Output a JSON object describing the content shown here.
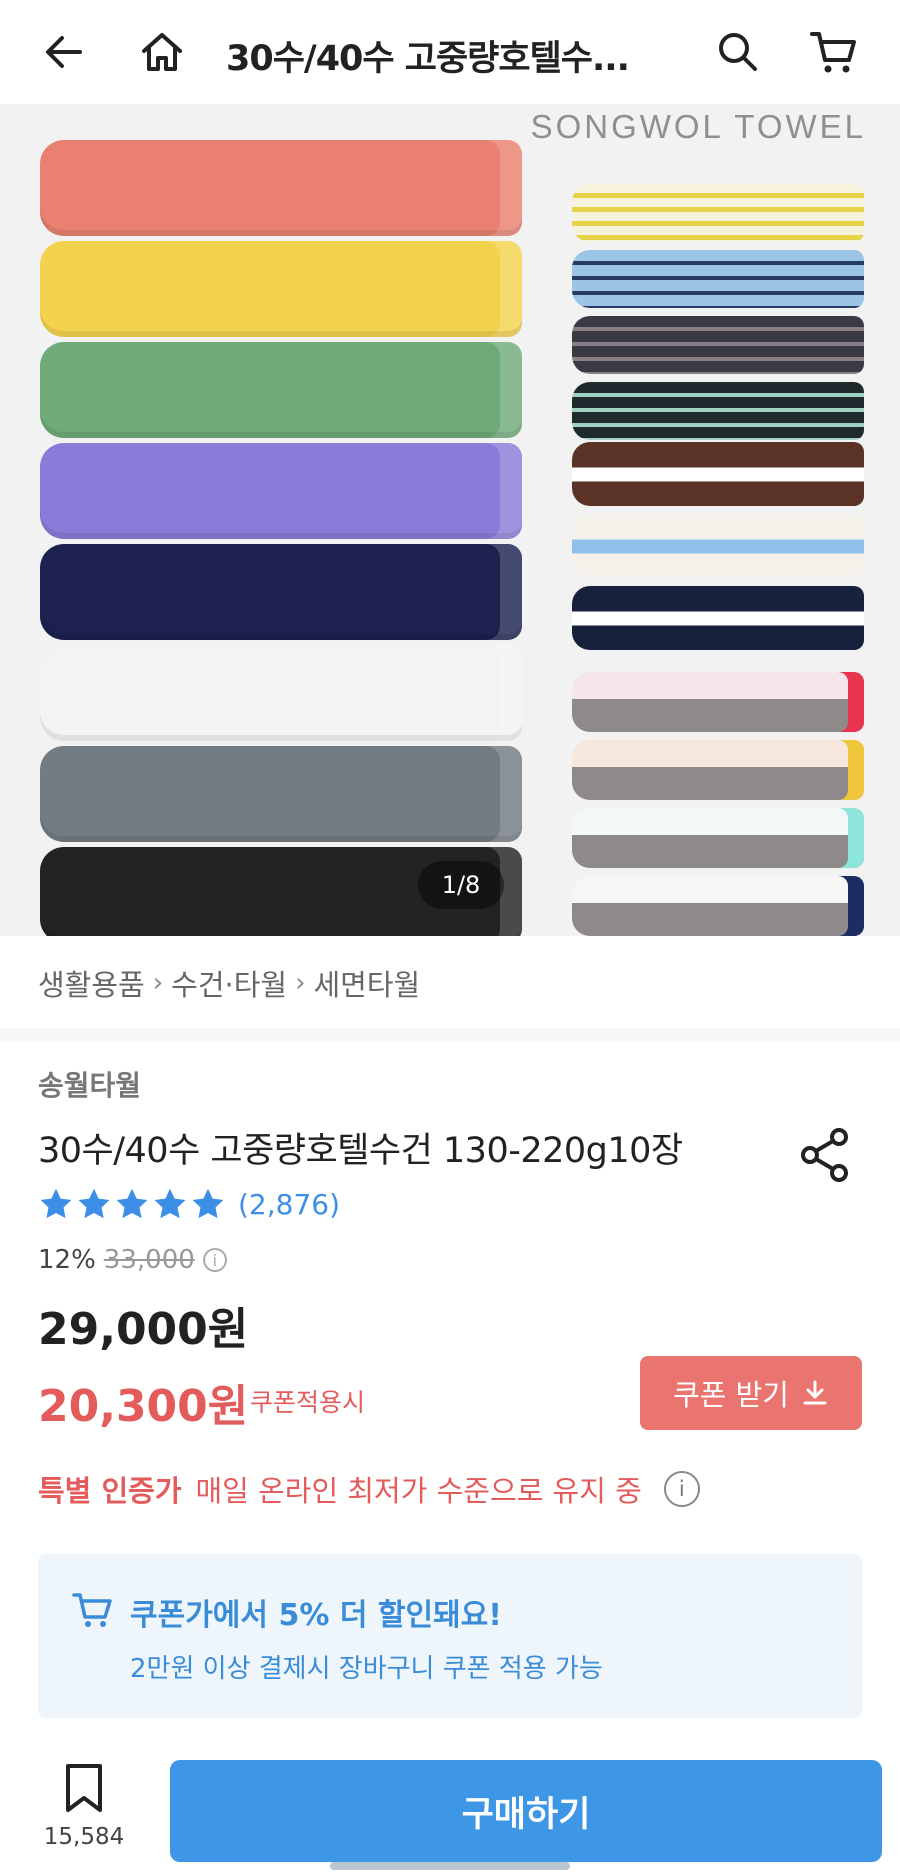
{
  "header": {
    "title": "30수/40수 고중량호텔수...",
    "back_icon": "arrow-left-icon",
    "home_icon": "home-icon",
    "search_icon": "search-icon",
    "cart_icon": "cart-icon"
  },
  "hero": {
    "brand_text": "SONGWOL TOWEL",
    "image_counter": "1/8",
    "towel_colors": [
      "#e98070",
      "#f3d24e",
      "#6fab79",
      "#8b7bd8",
      "#1c2150",
      "#f3f3f1",
      "#737c82",
      "#232323"
    ]
  },
  "breadcrumb": [
    "생활용품",
    "수건·타월",
    "세면타월"
  ],
  "product": {
    "seller": "송월타월",
    "name": "30수/40수 고중량호텔수건 130-220g10장",
    "rating_stars": 5,
    "review_count": "(2,876)",
    "discount_rate": "12%",
    "original_price": "33,000",
    "price": "29,000원",
    "coupon_price": "20,300원",
    "coupon_note": "쿠폰적용시",
    "coupon_button": "쿠폰 받기"
  },
  "special": {
    "title": "특별 인증가",
    "desc": "매일 온라인 최저가 수준으로 유지 중"
  },
  "notice": {
    "title": "쿠폰가에서 5% 더 할인돼요!",
    "subtitle": "2만원 이상 결제시 장바구니 쿠폰 적용 가능"
  },
  "bottom": {
    "bookmark_count": "15,584",
    "buy_label": "구매하기"
  },
  "colors": {
    "accent_blue": "#3d96e6",
    "sale_red": "#e35b5b",
    "star_blue": "#3c8ee6"
  }
}
